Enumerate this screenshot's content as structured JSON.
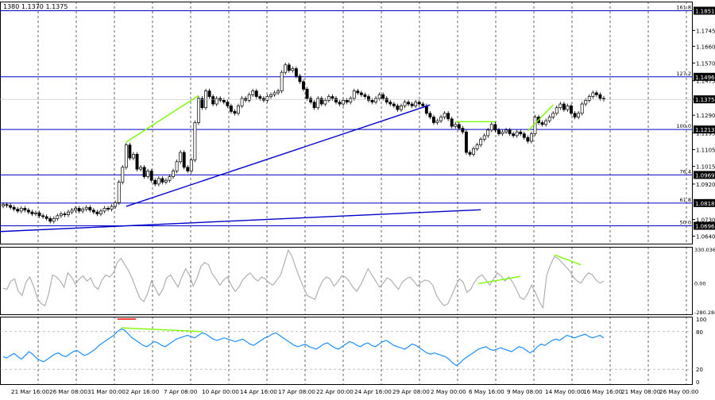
{
  "header": {
    "ohlc_text": "1380 1.1370 1.1375"
  },
  "colors": {
    "background": "#ffffff",
    "candle": "#000000",
    "fib_line": "#0000cc",
    "trend_line": "#0000cc",
    "divergence": "#7cfc00",
    "cci_line": "#b0b0b0",
    "stoch_line": "#1e90ff",
    "marker": "#ff0000",
    "grid": "#000000",
    "price_box": "#000000"
  },
  "chart_data": [
    {
      "type": "candlestick",
      "panel": "price",
      "ylim": [
        1.06,
        1.19
      ],
      "tick_labels": [
        "1.1745",
        "1.1660",
        "1.1570",
        "1.1475",
        "1.1375",
        "1.1290",
        "1.1195",
        "1.1105",
        "1.1015",
        "1.0920",
        "1.0730",
        "1.0640"
      ],
      "tick_values": [
        1.1745,
        1.166,
        1.157,
        1.1475,
        1.1375,
        1.129,
        1.1195,
        1.1105,
        1.1015,
        1.092,
        1.073,
        1.064
      ],
      "fib_levels": [
        {
          "ratio": "161.8",
          "price": "1.1851",
          "value": 1.1851
        },
        {
          "ratio": "127.2",
          "price": "1.1496",
          "value": 1.1496
        },
        {
          "ratio": "100.0",
          "price": "1.1213",
          "value": 1.1213
        },
        {
          "ratio": "76.4",
          "price": "1.0969",
          "value": 1.0969
        },
        {
          "ratio": "61.8",
          "price": "1.0818",
          "value": 1.0818
        },
        {
          "ratio": "50.0",
          "price": "1.0696",
          "value": 1.0696
        }
      ],
      "current_price": {
        "label": "1.1375",
        "value": 1.1375
      },
      "closes": [
        1.081,
        1.0805,
        1.0795,
        1.0785,
        1.0775,
        1.079,
        1.078,
        1.077,
        1.076,
        1.0765,
        1.075,
        1.0745,
        1.0735,
        1.072,
        1.0735,
        1.075,
        1.076,
        1.0755,
        1.077,
        1.078,
        1.079,
        1.0775,
        1.0785,
        1.0795,
        1.078,
        1.077,
        1.076,
        1.0775,
        1.079,
        1.0785,
        1.08,
        1.082,
        1.093,
        1.101,
        1.113,
        1.106,
        1.108,
        1.1,
        1.101,
        1.096,
        1.099,
        1.094,
        1.092,
        1.095,
        1.093,
        1.094,
        1.096,
        1.099,
        1.104,
        1.109,
        1.101,
        1.099,
        1.105,
        1.125,
        1.138,
        1.133,
        1.142,
        1.139,
        1.135,
        1.138,
        1.137,
        1.136,
        1.134,
        1.131,
        1.13,
        1.134,
        1.138,
        1.137,
        1.14,
        1.142,
        1.139,
        1.138,
        1.137,
        1.139,
        1.14,
        1.141,
        1.142,
        1.152,
        1.156,
        1.153,
        1.154,
        1.15,
        1.147,
        1.143,
        1.138,
        1.136,
        1.133,
        1.138,
        1.135,
        1.137,
        1.139,
        1.138,
        1.136,
        1.135,
        1.137,
        1.136,
        1.138,
        1.142,
        1.141,
        1.14,
        1.139,
        1.137,
        1.136,
        1.138,
        1.14,
        1.138,
        1.136,
        1.135,
        1.134,
        1.132,
        1.134,
        1.136,
        1.135,
        1.134,
        1.136,
        1.135,
        1.134,
        1.13,
        1.128,
        1.125,
        1.126,
        1.128,
        1.13,
        1.127,
        1.123,
        1.124,
        1.122,
        1.12,
        1.109,
        1.108,
        1.111,
        1.113,
        1.116,
        1.118,
        1.121,
        1.124,
        1.121,
        1.119,
        1.12,
        1.121,
        1.119,
        1.118,
        1.12,
        1.119,
        1.117,
        1.115,
        1.119,
        1.128,
        1.125,
        1.124,
        1.126,
        1.128,
        1.13,
        1.133,
        1.135,
        1.132,
        1.134,
        1.13,
        1.128,
        1.13,
        1.135,
        1.137,
        1.139,
        1.141,
        1.14,
        1.138,
        1.1375
      ]
    },
    {
      "type": "line",
      "panel": "cci",
      "ylim": [
        -280.2846,
        330.0361
      ],
      "tick_labels": [
        "330.0361",
        "0.00",
        "-280.2846"
      ],
      "tick_values": [
        330.0361,
        0,
        -280.2846
      ],
      "series": [
        {
          "values": [
            -50,
            -60,
            20,
            40,
            -80,
            -120,
            10,
            60,
            -30,
            -150,
            -200,
            -220,
            -100,
            80,
            60,
            20,
            -40,
            100,
            60,
            -10,
            40,
            70,
            20,
            50,
            -30,
            -60,
            30,
            80,
            60,
            100,
            200,
            240,
            180,
            120,
            40,
            -60,
            -150,
            -180,
            -100,
            20,
            -50,
            -120,
            -60,
            50,
            80,
            20,
            -40,
            60,
            140,
            80,
            -30,
            50,
            160,
            200,
            180,
            90,
            40,
            -20,
            30,
            60,
            -20,
            -80,
            -40,
            30,
            70,
            100,
            50,
            20,
            60,
            40,
            0,
            -20,
            30,
            80,
            200,
            320,
            260,
            150,
            50,
            -40,
            -120,
            -140,
            -160,
            -60,
            20,
            60,
            40,
            -30,
            10,
            70,
            60,
            20,
            -40,
            -80,
            -20,
            60,
            140,
            80,
            20,
            -40,
            0,
            50,
            30,
            -20,
            -60,
            10,
            40,
            60,
            20,
            -30,
            10,
            30,
            20,
            -20,
            -120,
            -180,
            -220,
            -200,
            -120,
            -30,
            40,
            10,
            -90,
            -60,
            10,
            60,
            80,
            30,
            -20,
            40,
            100,
            70,
            20,
            60,
            10,
            -60,
            -140,
            -160,
            -100,
            -20,
            -90,
            -180,
            -240,
            80,
            180,
            260,
            240,
            200,
            160,
            120,
            60,
            20,
            0,
            60,
            100,
            80,
            30,
            0,
            20
          ]
        }
      ]
    },
    {
      "type": "line",
      "panel": "stochastic",
      "ylim": [
        0,
        100
      ],
      "tick_labels": [
        "100",
        "80",
        "20",
        "0"
      ],
      "tick_values": [
        100,
        80,
        20,
        0
      ],
      "series": [
        {
          "values": [
            40,
            38,
            42,
            45,
            40,
            36,
            42,
            48,
            44,
            38,
            34,
            32,
            36,
            40,
            44,
            46,
            42,
            40,
            44,
            48,
            50,
            46,
            42,
            44,
            48,
            52,
            58,
            62,
            66,
            70,
            74,
            80,
            84,
            82,
            76,
            70,
            66,
            62,
            58,
            56,
            60,
            64,
            62,
            58,
            56,
            60,
            64,
            68,
            70,
            72,
            74,
            72,
            70,
            74,
            78,
            76,
            72,
            68,
            66,
            68,
            70,
            68,
            66,
            64,
            66,
            68,
            64,
            60,
            58,
            62,
            66,
            70,
            72,
            76,
            78,
            74,
            70,
            66,
            62,
            58,
            56,
            58,
            60,
            56,
            54,
            52,
            56,
            60,
            62,
            58,
            54,
            52,
            56,
            60,
            64,
            62,
            58,
            56,
            60,
            62,
            58,
            56,
            60,
            64,
            66,
            62,
            58,
            56,
            54,
            52,
            56,
            60,
            58,
            54,
            50,
            46,
            44,
            46,
            44,
            42,
            40,
            36,
            30,
            26,
            30,
            36,
            40,
            44,
            48,
            52,
            54,
            56,
            52,
            50,
            52,
            54,
            52,
            50,
            48,
            52,
            56,
            54,
            50,
            46,
            50,
            56,
            60,
            58,
            62,
            66,
            68,
            66,
            70,
            74,
            72,
            70,
            72,
            74,
            76,
            72,
            70,
            72,
            74,
            70
          ]
        }
      ]
    }
  ],
  "x_axis": {
    "labels": [
      "21 Mar 16:00",
      "26 Mar 08:00",
      "31 Mar 00:00",
      "2 Apr 16:00",
      "7 Apr 08:00",
      "10 Apr 00:00",
      "14 Apr 16:00",
      "17 Apr 08:00",
      "22 Apr 00:00",
      "24 Apr 16:00",
      "29 Apr 08:00",
      "2 May 00:00",
      "6 May 16:00",
      "9 May 08:00",
      "14 May 00:00",
      "16 May 16:00",
      "21 May 08:00",
      "26 May 00:00"
    ]
  }
}
